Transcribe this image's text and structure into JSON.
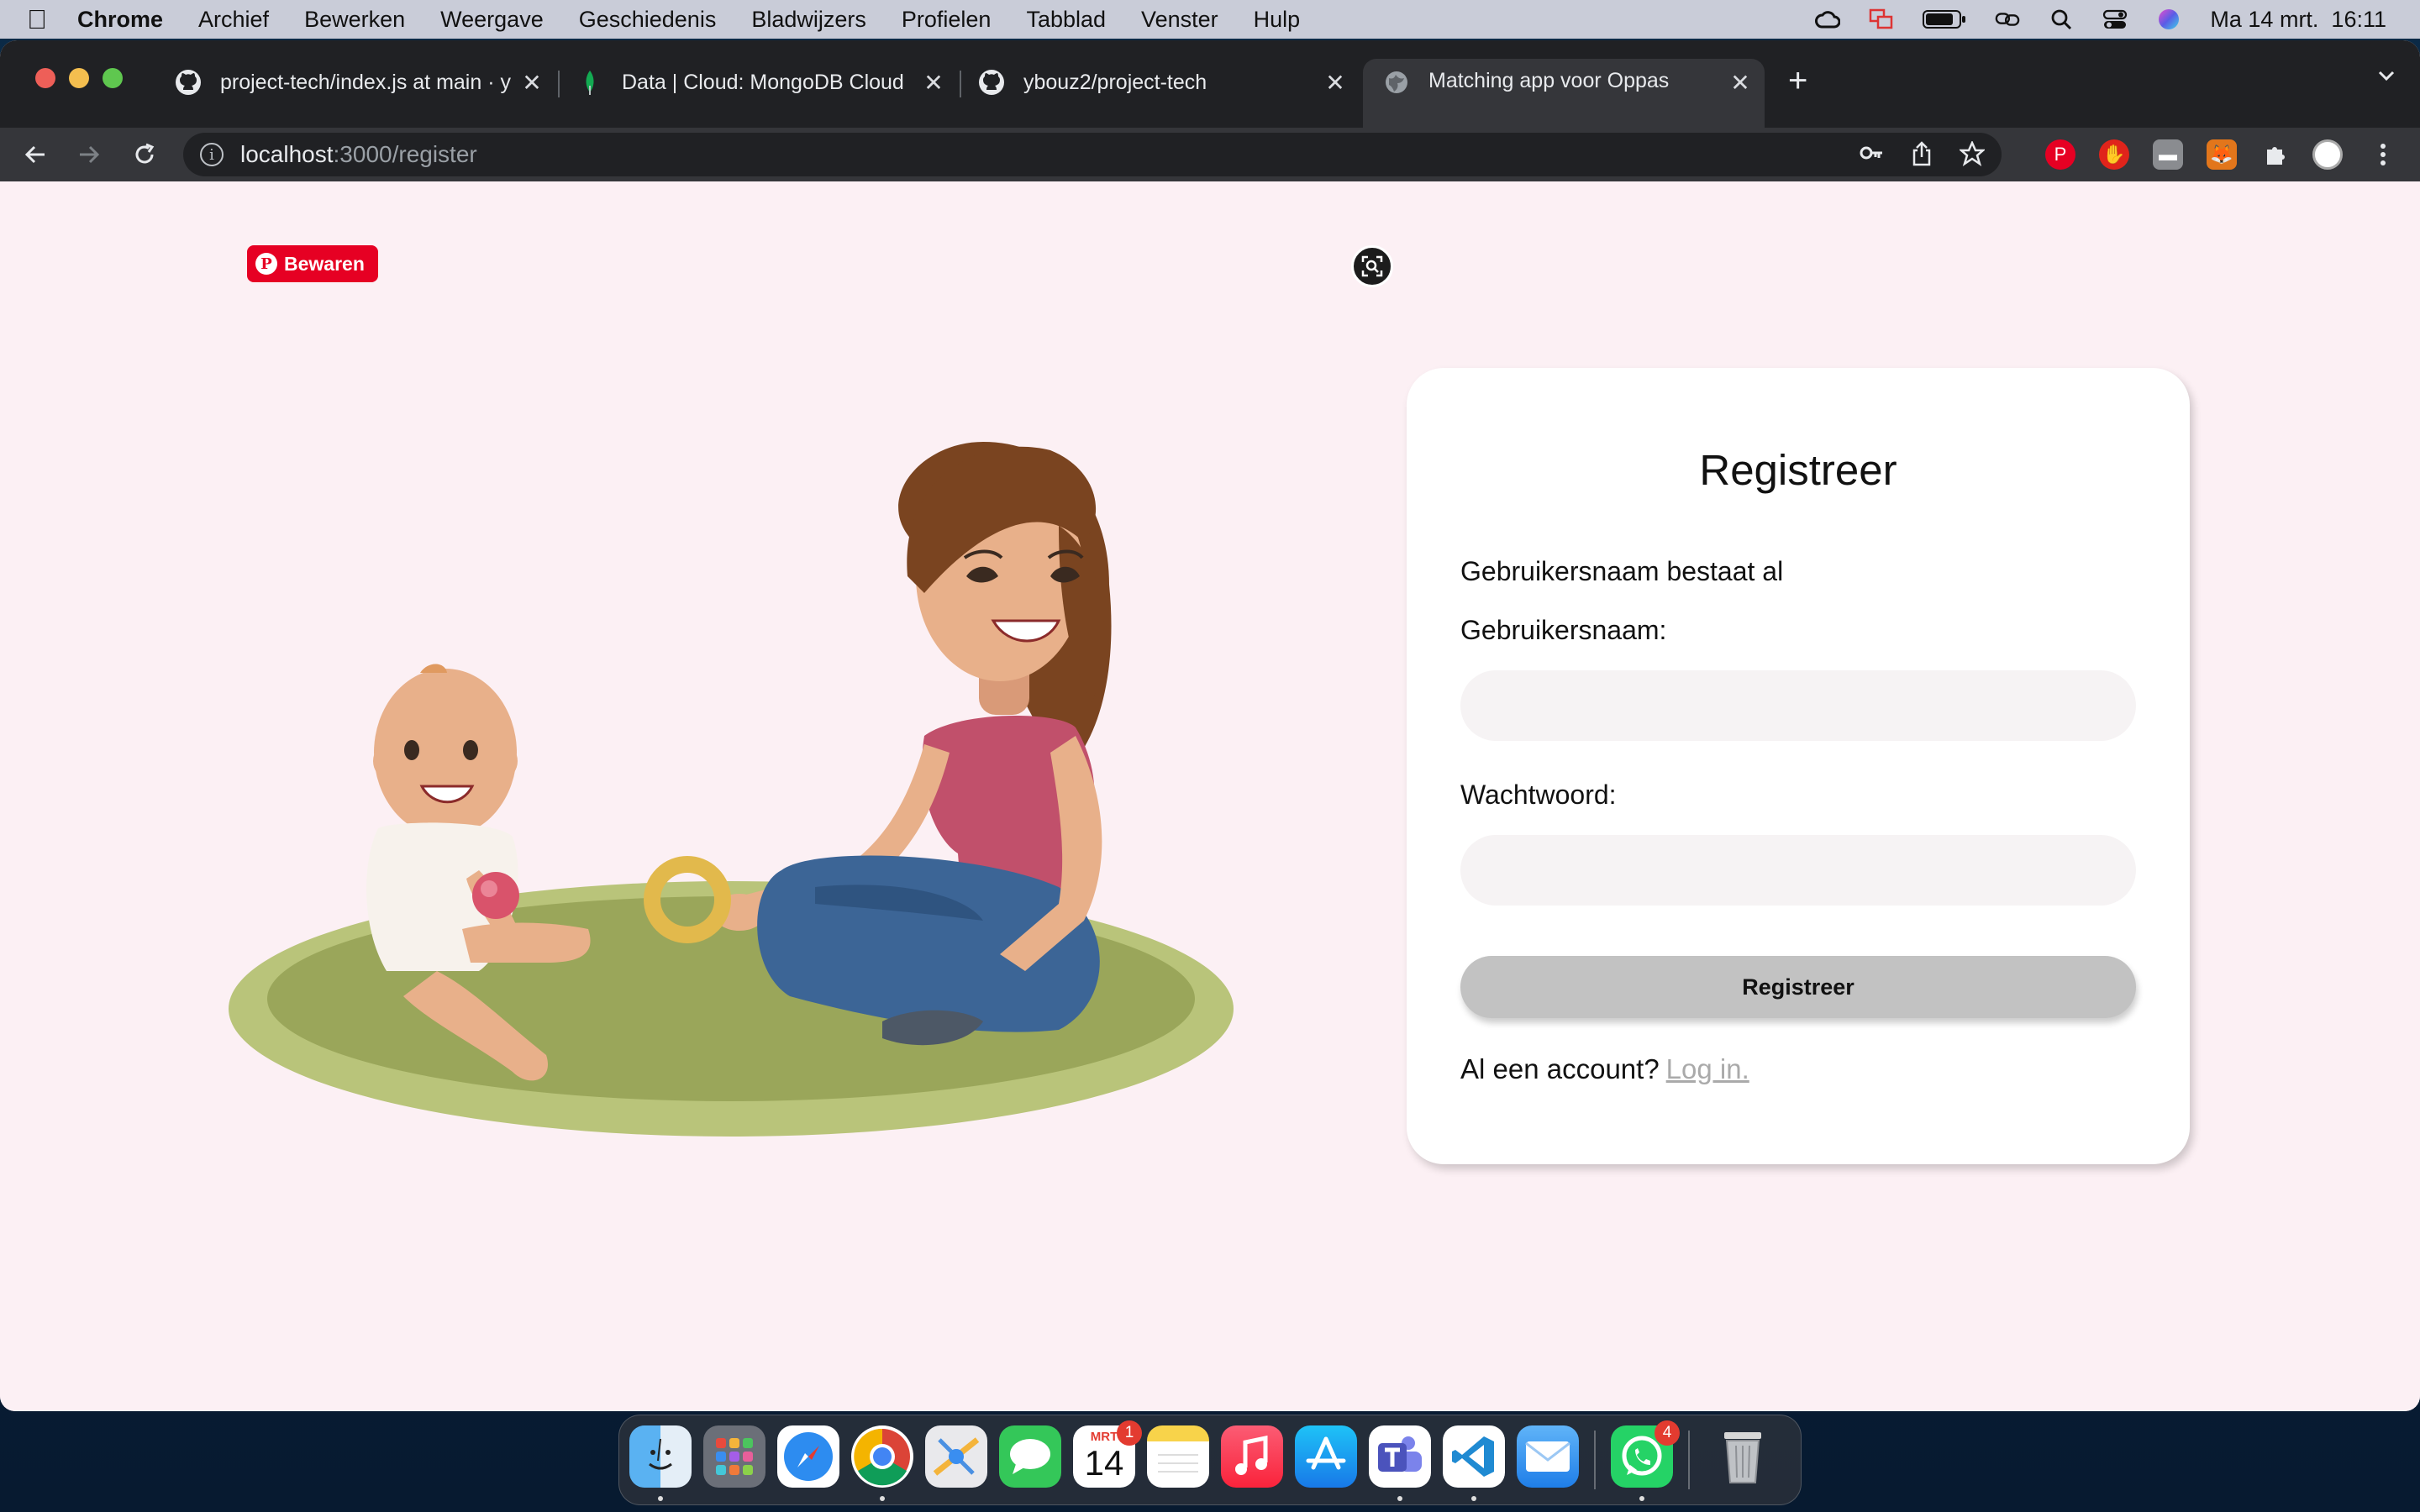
{
  "menubar": {
    "app_name": "Chrome",
    "menus": [
      "Archief",
      "Bewerken",
      "Weergave",
      "Geschiedenis",
      "Bladwijzers",
      "Profielen",
      "Tabblad",
      "Venster",
      "Hulp"
    ],
    "datetime": "Ma 14 mrt.  16:11"
  },
  "tabs": [
    {
      "title": "project-tech/index.js at main · y",
      "favicon": "github-icon"
    },
    {
      "title": "Data | Cloud: MongoDB Cloud",
      "favicon": "mongodb-leaf-icon"
    },
    {
      "title": "ybouz2/project-tech",
      "favicon": "github-icon"
    },
    {
      "title": "Matching app voor Oppas",
      "favicon": "globe-icon",
      "active": true
    }
  ],
  "address_bar": {
    "host": "localhost",
    "path": ":3000/register"
  },
  "page": {
    "pinterest_save_label": "Bewaren",
    "form": {
      "title": "Registreer",
      "error_message": "Gebruikersnaam bestaat al",
      "username_label": "Gebruikersnaam:",
      "username_value": "",
      "password_label": "Wachtwoord:",
      "password_value": "",
      "submit_label": "Registreer",
      "footer_text": "Al een account?",
      "login_link": "Log in."
    }
  },
  "dock": {
    "calendar_month": "MRT",
    "calendar_day": "14",
    "calendar_badge": "1",
    "whatsapp_badge": "4",
    "apps": [
      "finder",
      "launchpad",
      "safari",
      "chrome",
      "maps",
      "messages",
      "calendar",
      "notes",
      "music",
      "app-store",
      "teams",
      "vscode",
      "mail",
      "whatsapp",
      "trash"
    ]
  }
}
